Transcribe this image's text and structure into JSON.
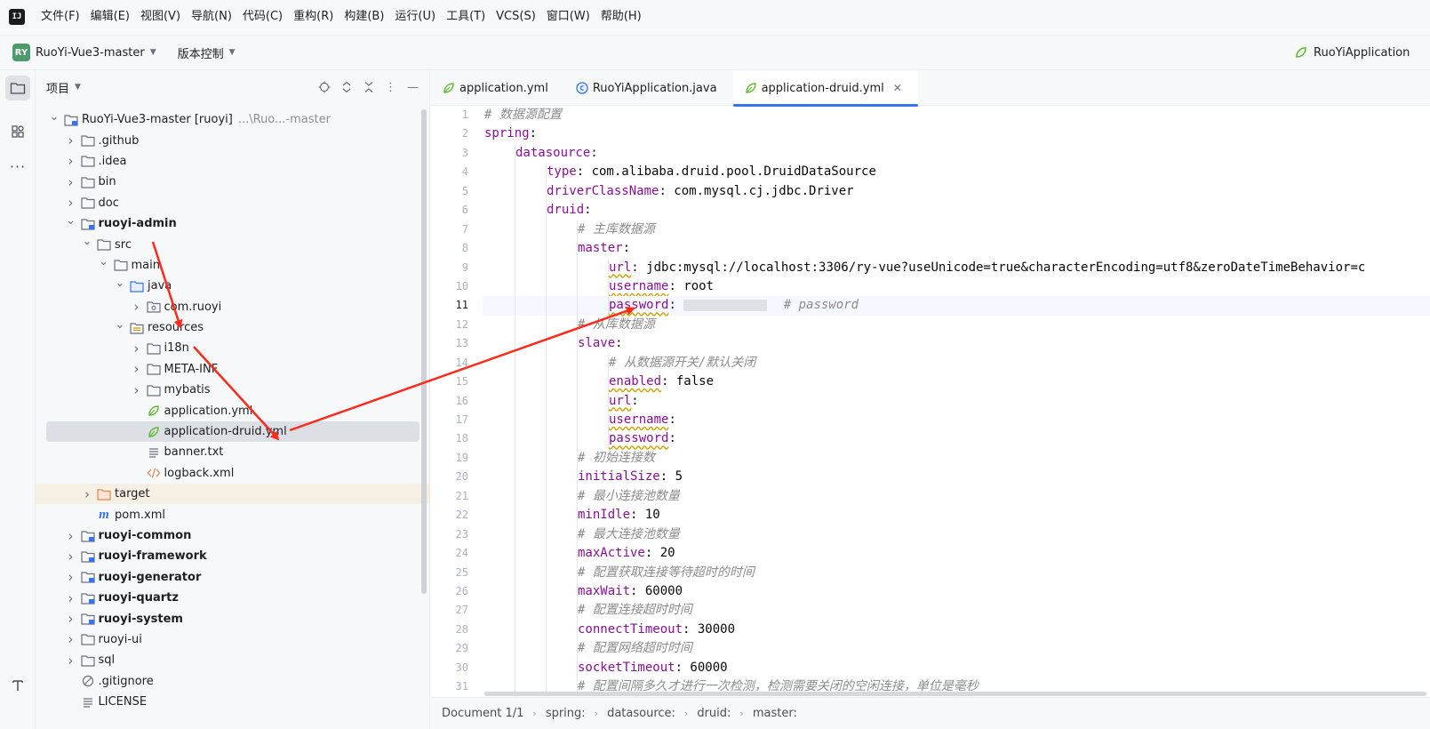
{
  "menubar": {
    "items": [
      "文件(F)",
      "编辑(E)",
      "视图(V)",
      "导航(N)",
      "代码(C)",
      "重构(R)",
      "构建(B)",
      "运行(U)",
      "工具(T)",
      "VCS(S)",
      "窗口(W)",
      "帮助(H)"
    ]
  },
  "toolbar": {
    "project_badge": "RY",
    "project_name": "RuoYi-Vue3-master",
    "vcs_label": "版本控制",
    "run_config": "RuoYiApplication"
  },
  "project_panel": {
    "title": "项目",
    "tree": [
      {
        "label": "RuoYi-Vue3-master [ruoyi]",
        "hint": "...\\Ruo...-master",
        "depth": 0,
        "expand": "open",
        "icon": "module-folder",
        "bold": false
      },
      {
        "label": ".github",
        "depth": 1,
        "expand": "closed",
        "icon": "folder"
      },
      {
        "label": ".idea",
        "depth": 1,
        "expand": "closed",
        "icon": "folder"
      },
      {
        "label": "bin",
        "depth": 1,
        "expand": "closed",
        "icon": "folder"
      },
      {
        "label": "doc",
        "depth": 1,
        "expand": "closed",
        "icon": "folder"
      },
      {
        "label": "ruoyi-admin",
        "depth": 1,
        "expand": "open",
        "icon": "module-folder",
        "bold": true
      },
      {
        "label": "src",
        "depth": 2,
        "expand": "open",
        "icon": "folder"
      },
      {
        "label": "main",
        "depth": 3,
        "expand": "open",
        "icon": "folder"
      },
      {
        "label": "java",
        "depth": 4,
        "expand": "open",
        "icon": "source-folder"
      },
      {
        "label": "com.ruoyi",
        "depth": 5,
        "expand": "closed",
        "icon": "package"
      },
      {
        "label": "resources",
        "depth": 4,
        "expand": "open",
        "icon": "resources-folder"
      },
      {
        "label": "i18n",
        "depth": 5,
        "expand": "closed",
        "icon": "folder"
      },
      {
        "label": "META-INF",
        "depth": 5,
        "expand": "closed",
        "icon": "folder"
      },
      {
        "label": "mybatis",
        "depth": 5,
        "expand": "closed",
        "icon": "folder"
      },
      {
        "label": "application.yml",
        "depth": 5,
        "expand": "none",
        "icon": "yml"
      },
      {
        "label": "application-druid.yml",
        "depth": 5,
        "expand": "none",
        "icon": "yml",
        "selected": true
      },
      {
        "label": "banner.txt",
        "depth": 5,
        "expand": "none",
        "icon": "text"
      },
      {
        "label": "logback.xml",
        "depth": 5,
        "expand": "none",
        "icon": "xml"
      },
      {
        "label": "target",
        "depth": 2,
        "expand": "closed",
        "icon": "excluded-folder",
        "excluded": true
      },
      {
        "label": "pom.xml",
        "depth": 2,
        "expand": "none",
        "icon": "maven"
      },
      {
        "label": "ruoyi-common",
        "depth": 1,
        "expand": "closed",
        "icon": "module-folder",
        "bold": true
      },
      {
        "label": "ruoyi-framework",
        "depth": 1,
        "expand": "closed",
        "icon": "module-folder",
        "bold": true
      },
      {
        "label": "ruoyi-generator",
        "depth": 1,
        "expand": "closed",
        "icon": "module-folder",
        "bold": true
      },
      {
        "label": "ruoyi-quartz",
        "depth": 1,
        "expand": "closed",
        "icon": "module-folder",
        "bold": true
      },
      {
        "label": "ruoyi-system",
        "depth": 1,
        "expand": "closed",
        "icon": "module-folder",
        "bold": true
      },
      {
        "label": "ruoyi-ui",
        "depth": 1,
        "expand": "closed",
        "icon": "folder"
      },
      {
        "label": "sql",
        "depth": 1,
        "expand": "closed",
        "icon": "folder"
      },
      {
        "label": ".gitignore",
        "depth": 1,
        "expand": "none",
        "icon": "ignore"
      },
      {
        "label": "LICENSE",
        "depth": 1,
        "expand": "none",
        "icon": "text"
      }
    ]
  },
  "editor": {
    "tabs": [
      {
        "label": "application.yml",
        "active": false
      },
      {
        "label": "RuoYiApplication.java",
        "active": false
      },
      {
        "label": "application-druid.yml",
        "active": true
      }
    ],
    "current_line": 11,
    "lines": [
      {
        "n": "1",
        "indent": 0,
        "parts": [
          {
            "t": "# 数据源配置",
            "c": "c"
          }
        ]
      },
      {
        "n": "2",
        "indent": 0,
        "parts": [
          {
            "t": "spring",
            "c": "k"
          },
          {
            "t": ":",
            "c": "v"
          }
        ]
      },
      {
        "n": "3",
        "indent": 1,
        "parts": [
          {
            "t": "datasource",
            "c": "k"
          },
          {
            "t": ":",
            "c": "v"
          }
        ]
      },
      {
        "n": "4",
        "indent": 2,
        "parts": [
          {
            "t": "type",
            "c": "k"
          },
          {
            "t": ": com.alibaba.druid.pool.DruidDataSource",
            "c": "v"
          }
        ]
      },
      {
        "n": "5",
        "indent": 2,
        "parts": [
          {
            "t": "driverClassName",
            "c": "k"
          },
          {
            "t": ": com.mysql.cj.jdbc.Driver",
            "c": "v"
          }
        ]
      },
      {
        "n": "6",
        "indent": 2,
        "parts": [
          {
            "t": "druid",
            "c": "k"
          },
          {
            "t": ":",
            "c": "v"
          }
        ]
      },
      {
        "n": "7",
        "indent": 3,
        "parts": [
          {
            "t": "# 主库数据源",
            "c": "c"
          }
        ]
      },
      {
        "n": "8",
        "indent": 3,
        "parts": [
          {
            "t": "master",
            "c": "k"
          },
          {
            "t": ":",
            "c": "v"
          }
        ]
      },
      {
        "n": "9",
        "indent": 4,
        "parts": [
          {
            "t": "url",
            "c": "k sq"
          },
          {
            "t": ": jdbc:mysql://localhost:3306/ry-vue?useUnicode=true&characterEncoding=utf8&zeroDateTimeBehavior=c",
            "c": "v"
          }
        ]
      },
      {
        "n": "10",
        "indent": 4,
        "parts": [
          {
            "t": "username",
            "c": "k sq"
          },
          {
            "t": ": root",
            "c": "v"
          }
        ]
      },
      {
        "n": "11",
        "indent": 4,
        "parts": [
          {
            "t": "password",
            "c": "k sq"
          },
          {
            "t": ": ",
            "c": "v"
          },
          {
            "t": "",
            "c": "mask"
          },
          {
            "t": " # password",
            "c": "c"
          }
        ]
      },
      {
        "n": "12",
        "indent": 3,
        "parts": [
          {
            "t": "# 从库数据源",
            "c": "c"
          }
        ]
      },
      {
        "n": "13",
        "indent": 3,
        "parts": [
          {
            "t": "slave",
            "c": "k"
          },
          {
            "t": ":",
            "c": "v"
          }
        ]
      },
      {
        "n": "14",
        "indent": 4,
        "parts": [
          {
            "t": "# 从数据源开关/默认关闭",
            "c": "c"
          }
        ]
      },
      {
        "n": "15",
        "indent": 4,
        "parts": [
          {
            "t": "enabled",
            "c": "k sq"
          },
          {
            "t": ": false",
            "c": "v"
          }
        ]
      },
      {
        "n": "16",
        "indent": 4,
        "parts": [
          {
            "t": "url",
            "c": "k sq"
          },
          {
            "t": ":",
            "c": "v"
          }
        ]
      },
      {
        "n": "17",
        "indent": 4,
        "parts": [
          {
            "t": "username",
            "c": "k sq"
          },
          {
            "t": ":",
            "c": "v"
          }
        ]
      },
      {
        "n": "18",
        "indent": 4,
        "parts": [
          {
            "t": "password",
            "c": "k sq"
          },
          {
            "t": ":",
            "c": "v"
          }
        ]
      },
      {
        "n": "19",
        "indent": 3,
        "parts": [
          {
            "t": "# 初始连接数",
            "c": "c"
          }
        ]
      },
      {
        "n": "20",
        "indent": 3,
        "parts": [
          {
            "t": "initialSize",
            "c": "k"
          },
          {
            "t": ": 5",
            "c": "v"
          }
        ]
      },
      {
        "n": "21",
        "indent": 3,
        "parts": [
          {
            "t": "# 最小连接池数量",
            "c": "c"
          }
        ]
      },
      {
        "n": "22",
        "indent": 3,
        "parts": [
          {
            "t": "minIdle",
            "c": "k"
          },
          {
            "t": ": 10",
            "c": "v"
          }
        ]
      },
      {
        "n": "23",
        "indent": 3,
        "parts": [
          {
            "t": "# 最大连接池数量",
            "c": "c"
          }
        ]
      },
      {
        "n": "24",
        "indent": 3,
        "parts": [
          {
            "t": "maxActive",
            "c": "k"
          },
          {
            "t": ": 20",
            "c": "v"
          }
        ]
      },
      {
        "n": "25",
        "indent": 3,
        "parts": [
          {
            "t": "# 配置获取连接等待超时的时间",
            "c": "c"
          }
        ]
      },
      {
        "n": "26",
        "indent": 3,
        "parts": [
          {
            "t": "maxWait",
            "c": "k"
          },
          {
            "t": ": 60000",
            "c": "v"
          }
        ]
      },
      {
        "n": "27",
        "indent": 3,
        "parts": [
          {
            "t": "# 配置连接超时时间",
            "c": "c"
          }
        ]
      },
      {
        "n": "28",
        "indent": 3,
        "parts": [
          {
            "t": "connectTimeout",
            "c": "k"
          },
          {
            "t": ": 30000",
            "c": "v"
          }
        ]
      },
      {
        "n": "29",
        "indent": 3,
        "parts": [
          {
            "t": "# 配置网络超时时间",
            "c": "c"
          }
        ]
      },
      {
        "n": "30",
        "indent": 3,
        "parts": [
          {
            "t": "socketTimeout",
            "c": "k"
          },
          {
            "t": ": 60000",
            "c": "v"
          }
        ]
      },
      {
        "n": "31",
        "indent": 3,
        "parts": [
          {
            "t": "# 配置间隔多久才进行一次检测，检测需要关闭的空闲连接，单位是毫秒",
            "c": "c"
          }
        ]
      }
    ]
  },
  "statusbar": {
    "breadcrumbs": [
      "Document 1/1",
      "spring:",
      "datasource:",
      "druid:",
      "master:"
    ]
  },
  "colors": {
    "accent": "#3574f0",
    "annotation": "#ff2a1a",
    "yaml_key": "#871094",
    "comment": "#8c8c8c"
  }
}
